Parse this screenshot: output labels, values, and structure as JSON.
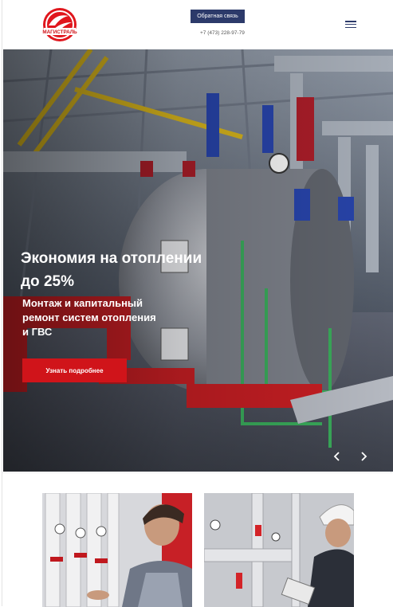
{
  "header": {
    "logo_text": "МАГИСТРАЛЬ",
    "cta_label": "Обратная связь",
    "phone": "+7 (473) 228-97-79"
  },
  "hero": {
    "title": "Экономия на отоплении до 25%",
    "subtitle": "Монтаж и капитальный ремонт систем отопления и ГВС",
    "button_label": "Узнать подробнее"
  },
  "icons": {
    "menu": "hamburger-icon",
    "prev": "chevron-left-icon",
    "next": "chevron-right-icon"
  },
  "colors": {
    "brand_navy": "#2c3a6a",
    "accent_red": "#d0141a"
  }
}
